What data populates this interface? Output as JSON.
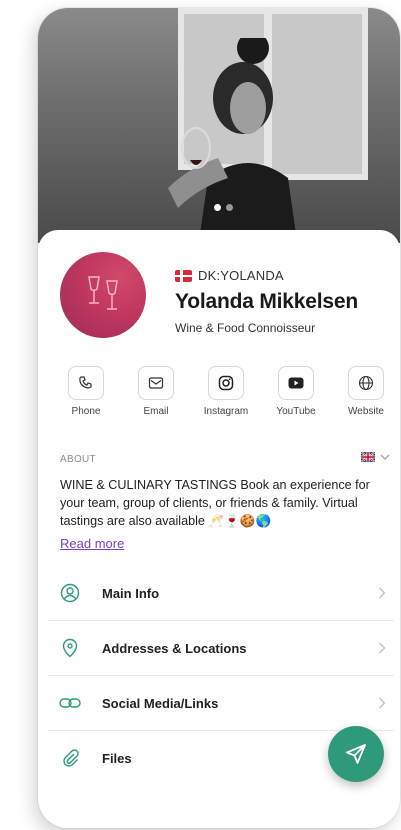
{
  "profile": {
    "handle": "DK:YOLANDA",
    "name": "Yolanda Mikkelsen",
    "tagline": "Wine & Food Connoisseur",
    "avatar_color": "#c2385f"
  },
  "carousel": {
    "dots": 2,
    "active": 1
  },
  "actions": [
    {
      "label": "Phone",
      "icon": "phone-icon"
    },
    {
      "label": "Email",
      "icon": "email-icon"
    },
    {
      "label": "Instagram",
      "icon": "instagram-icon"
    },
    {
      "label": "YouTube",
      "icon": "youtube-icon"
    },
    {
      "label": "Website",
      "icon": "globe-icon"
    }
  ],
  "about": {
    "heading": "ABOUT",
    "text": "WINE & CULINARY TASTINGS Book an experience for your team, group of clients, or friends & family. Virtual tastings are also available 🥂🍷🍪🌎",
    "read_more": "Read more"
  },
  "menu": [
    {
      "label": "Main Info",
      "icon": "user-icon"
    },
    {
      "label": "Addresses & Locations",
      "icon": "location-icon"
    },
    {
      "label": "Social Media/Links",
      "icon": "link-icon"
    },
    {
      "label": "Files",
      "icon": "paperclip-icon"
    }
  ],
  "colors": {
    "accent": "#2f9a7b",
    "icon_teal": "#2f9a7b",
    "link": "#7b3fbf"
  }
}
